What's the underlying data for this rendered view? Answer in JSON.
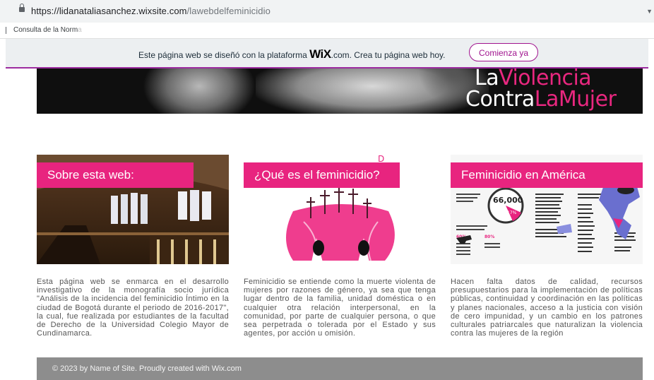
{
  "browser": {
    "url_host": "https://lidanataliasanchez.wixsite.com",
    "url_path": "/lawebdelfeminicidio",
    "bookmark_label": "Consulta de la Norm",
    "bookmark_faded": "a"
  },
  "wix_banner": {
    "text_before": "Este página web se diseñó con la plataforma ",
    "logo": "WiX",
    "text_after": ".com. Crea tu página web hoy.",
    "button_label": "Comienza ya"
  },
  "hero": {
    "line1_a": "La",
    "line1_b": "Violencia",
    "line2_a": "Contra",
    "line2_b": "LaMujer"
  },
  "cards": [
    {
      "title": "Sobre esta web:",
      "description": "Esta página web se enmarca en el desarrollo investigativo de la monografía socio jurídica \"Análisis de la incidencia del feminicidio Íntimo en la ciudad de Bogotá durante el periodo de 2016-2017\", la cual, fue realizada por estudiantes de la facultad de Derecho de la Universidad Colegio Mayor de Cundinamarca."
    },
    {
      "title": "¿Qué es el feminicidio?",
      "description": "Feminicidio se entiende como la muerte violenta de mujeres por razones de género, ya sea que tenga lugar dentro de la familia, unidad doméstica o en cualquier otra relación interpersonal, en la comunidad, por parte de cualquier persona, o que sea perpetrada o tolerada por el Estado y sus agentes, por acción u omisión."
    },
    {
      "title": "Feminicidio en América",
      "description": "Hacen falta datos de calidad, recursos presupuestarios para la implementación de políticas públicas, continuidad y coordinación en las políticas y planes nacionales, acceso a la justicia con visión de cero impunidad, y un cambio en los patrones culturales patriarcales que naturalizan la violencia contra las mujeres de la región"
    }
  ],
  "infographic": {
    "big_number": "66,000",
    "percent": "17%",
    "stat_a": "60%",
    "stat_b": "80%"
  },
  "footer": {
    "text": "© 2023 by Name of Site. Proudly created with Wix.com"
  },
  "colors": {
    "accent_pink": "#e8247f",
    "wix_purple": "#a0138e",
    "footer_gray": "#8d8d8d"
  }
}
